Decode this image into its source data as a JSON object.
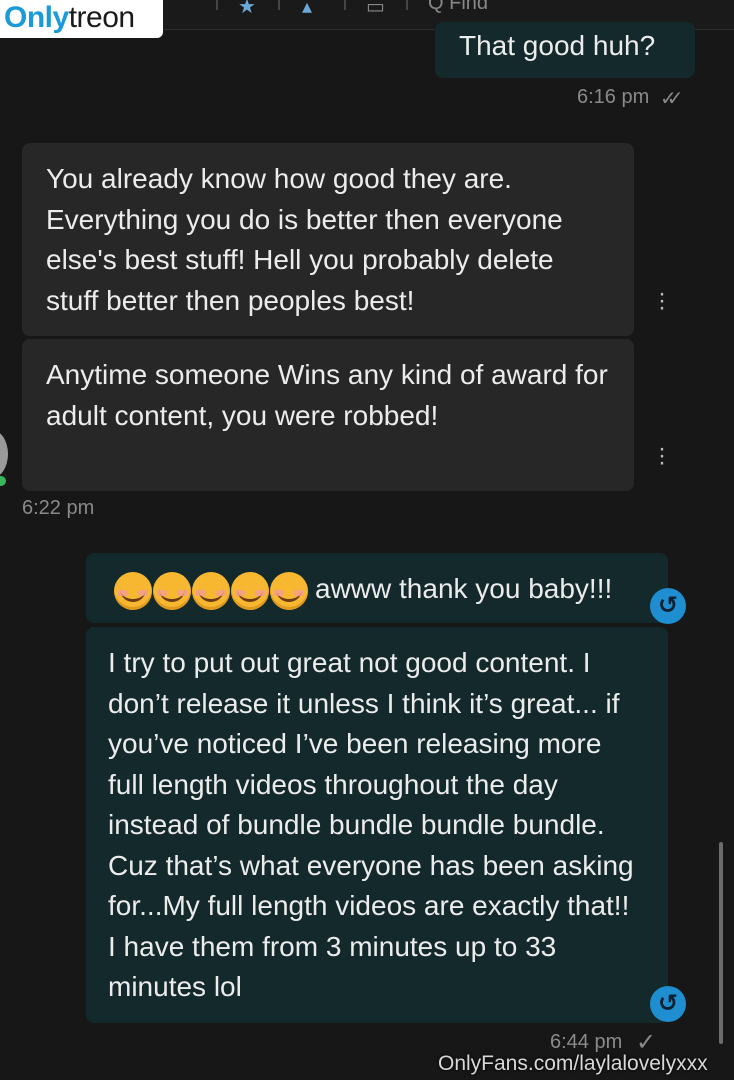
{
  "header": {
    "find_label": "Q Find",
    "icons": [
      "star-icon",
      "bell-icon",
      "image-icon",
      "search-icon"
    ]
  },
  "watermark": {
    "part1": "Only",
    "part2": "treon"
  },
  "messages": [
    {
      "direction": "outgoing",
      "text": "That good huh?",
      "time": "6:16 pm",
      "status": "read"
    },
    {
      "direction": "incoming",
      "text": "You already know how good they are. Everything you do is better then everyone else's best stuff! Hell you probably delete stuff better then peoples best!"
    },
    {
      "direction": "incoming",
      "text": "Anytime someone Wins any kind of award for adult content, you were robbed!",
      "time": "6:22 pm"
    },
    {
      "direction": "outgoing",
      "emoji": "☺☺☺☺☺",
      "text": "awww thank you baby!!!"
    },
    {
      "direction": "outgoing",
      "text": "I try to put out great not good content. I don’t release it unless I think it’s great... if you’ve noticed I’ve been releasing more full length videos throughout the day instead of bundle bundle bundle bundle. Cuz that’s what everyone has been asking for...My full length videos are exactly that!! I have them from 3 minutes up to 33 minutes lol",
      "time": "6:44 pm",
      "status": "sent"
    }
  ],
  "footer": {
    "watermark": "OnlyFans.com/laylalovelyxxx"
  },
  "colors": {
    "outgoing_bubble": "#13292c",
    "incoming_bubble": "#272727",
    "accent": "#1f8ed0"
  }
}
